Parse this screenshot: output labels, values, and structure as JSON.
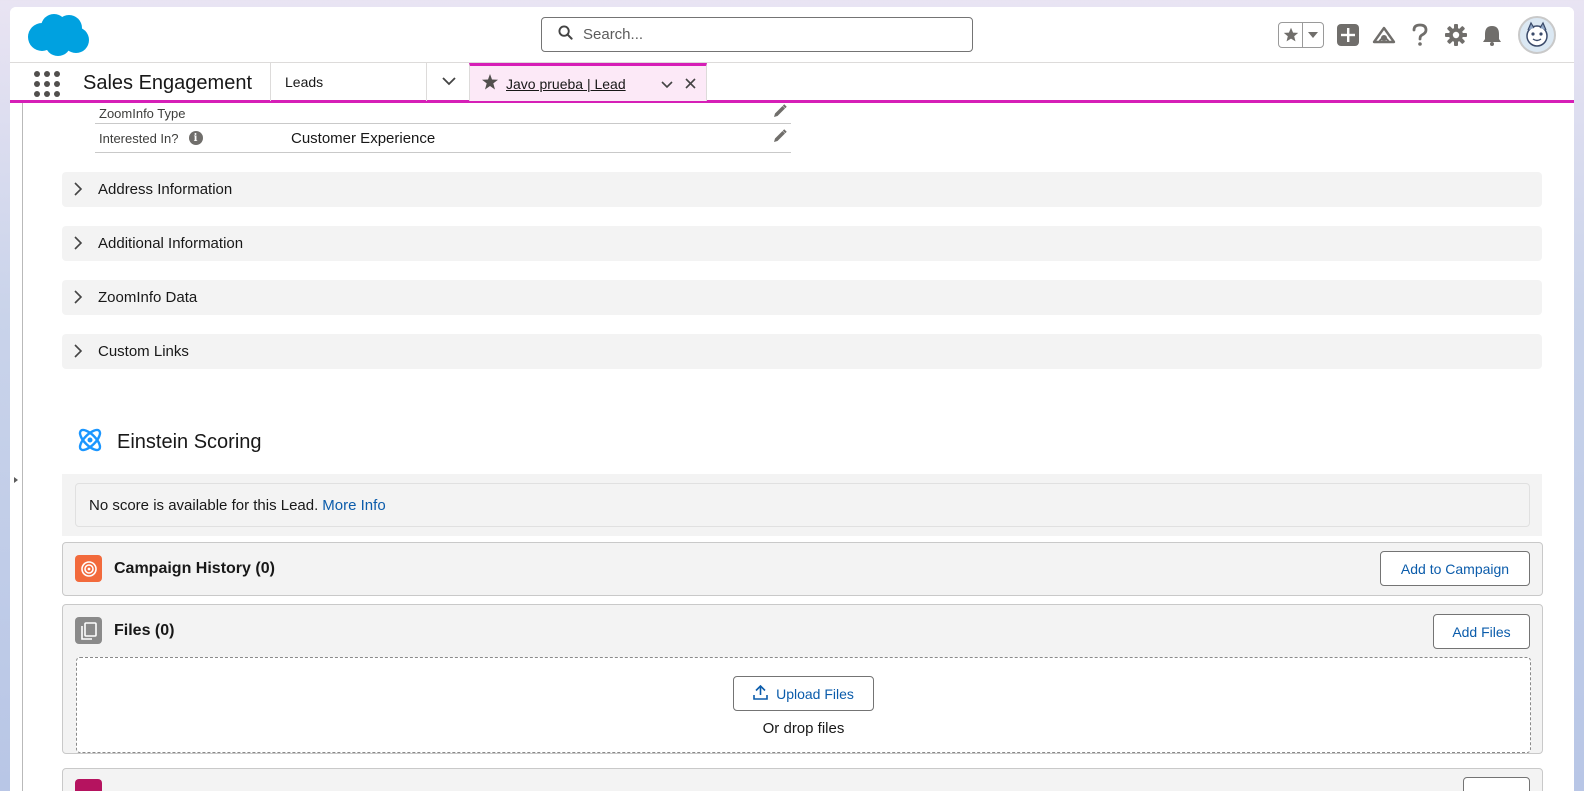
{
  "header": {
    "search_placeholder": "Search...",
    "icons": [
      "favorites-star-icon",
      "favorites-caret-icon",
      "global-actions-plus-icon",
      "trailhead-icon",
      "help-icon",
      "setup-gear-icon",
      "notifications-bell-icon",
      "user-avatar"
    ]
  },
  "nav": {
    "app_name": "Sales Engagement",
    "object_tab": "Leads",
    "record_tab": "Javo prueba | Lead"
  },
  "fields": [
    {
      "label": "ZoomInfo Type",
      "value": ""
    },
    {
      "label": "Interested In?",
      "value": "Customer Experience"
    }
  ],
  "sections": [
    {
      "title": "Address Information"
    },
    {
      "title": "Additional Information"
    },
    {
      "title": "ZoomInfo Data"
    },
    {
      "title": "Custom Links"
    }
  ],
  "einstein": {
    "title": "Einstein Scoring",
    "message": "No score is available for this Lead.",
    "link": "More Info"
  },
  "campaign_history": {
    "title": "Campaign History (0)",
    "button": "Add to Campaign"
  },
  "files": {
    "title": "Files (0)",
    "button": "Add Files",
    "upload_button": "Upload Files",
    "drop_text": "Or drop files"
  },
  "colors": {
    "accent": "#d61fb7",
    "link": "#0b5cab",
    "salesforce_blue": "#00a1e0",
    "campaign_icon": "#f26a3c",
    "files_icon": "#8a8a8a"
  }
}
